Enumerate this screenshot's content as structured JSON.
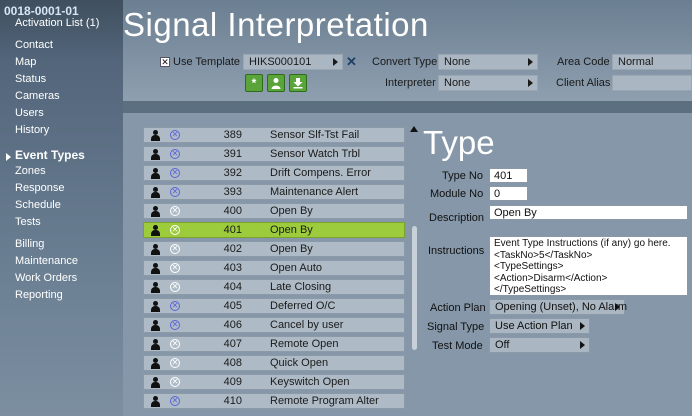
{
  "sidebar": {
    "account": "0018-0001-01",
    "activation_list": "Activation List (1)",
    "items": [
      {
        "label": "Contact"
      },
      {
        "label": "Map"
      },
      {
        "label": "Status"
      },
      {
        "label": "Cameras"
      },
      {
        "label": "Users"
      },
      {
        "label": "History"
      },
      {
        "label": "Event Types",
        "active": true
      },
      {
        "label": "Zones"
      },
      {
        "label": "Response"
      },
      {
        "label": "Schedule"
      },
      {
        "label": "Tests"
      },
      {
        "label": "Billing"
      },
      {
        "label": "Maintenance"
      },
      {
        "label": "Work Orders"
      },
      {
        "label": "Reporting"
      }
    ]
  },
  "header": {
    "title": "Signal Interpretation",
    "use_template_label": "Use Template",
    "use_template_checked": "✕",
    "template_value": "HIKS000101",
    "convert_type_label": "Convert Type",
    "convert_type_value": "None",
    "interpreter_label": "Interpreter",
    "interpreter_value": "None",
    "area_code_label": "Area Code",
    "area_code_value": "Normal",
    "client_alias_label": "Client Alias",
    "client_alias_value": ""
  },
  "events": [
    {
      "num": "389",
      "name": "Sensor Slf-Tst Fail",
      "icon": "blue"
    },
    {
      "num": "391",
      "name": "Sensor Watch Trbl",
      "icon": "blue"
    },
    {
      "num": "392",
      "name": "Drift Compens. Error",
      "icon": "blue"
    },
    {
      "num": "393",
      "name": "Maintenance Alert",
      "icon": "blue"
    },
    {
      "num": "400",
      "name": "Open By",
      "icon": "grey"
    },
    {
      "num": "401",
      "name": "Open By",
      "icon": "grey",
      "selected": true
    },
    {
      "num": "402",
      "name": "Open By",
      "icon": "grey"
    },
    {
      "num": "403",
      "name": "Open Auto",
      "icon": "grey"
    },
    {
      "num": "404",
      "name": "Late Closing",
      "icon": "grey"
    },
    {
      "num": "405",
      "name": "Deferred O/C",
      "icon": "blue"
    },
    {
      "num": "406",
      "name": "Cancel by user",
      "icon": "blue"
    },
    {
      "num": "407",
      "name": "Remote Open",
      "icon": "grey"
    },
    {
      "num": "408",
      "name": "Quick Open",
      "icon": "grey"
    },
    {
      "num": "409",
      "name": "Keyswitch Open",
      "icon": "grey"
    },
    {
      "num": "410",
      "name": "Remote Program Alter",
      "icon": "blue"
    }
  ],
  "detail": {
    "heading": "Type",
    "type_no_label": "Type No",
    "type_no": "401",
    "module_no_label": "Module No",
    "module_no": "0",
    "description_label": "Description",
    "description": "Open By",
    "instructions_label": "Instructions",
    "instructions": "Event Type Instructions (if any) go here.\n<TaskNo>5</TaskNo>\n<TypeSettings>\n<Action>Disarm</Action>\n</TypeSettings>",
    "action_plan_label": "Action Plan",
    "action_plan": "Opening (Unset), No Alarm",
    "signal_type_label": "Signal Type",
    "signal_type": "Use Action Plan",
    "test_mode_label": "Test Mode",
    "test_mode": "Off"
  },
  "colors": {
    "selected_row": "#9ccc3c",
    "row": "#aebbc6",
    "accent_button": "#5aa43a"
  }
}
